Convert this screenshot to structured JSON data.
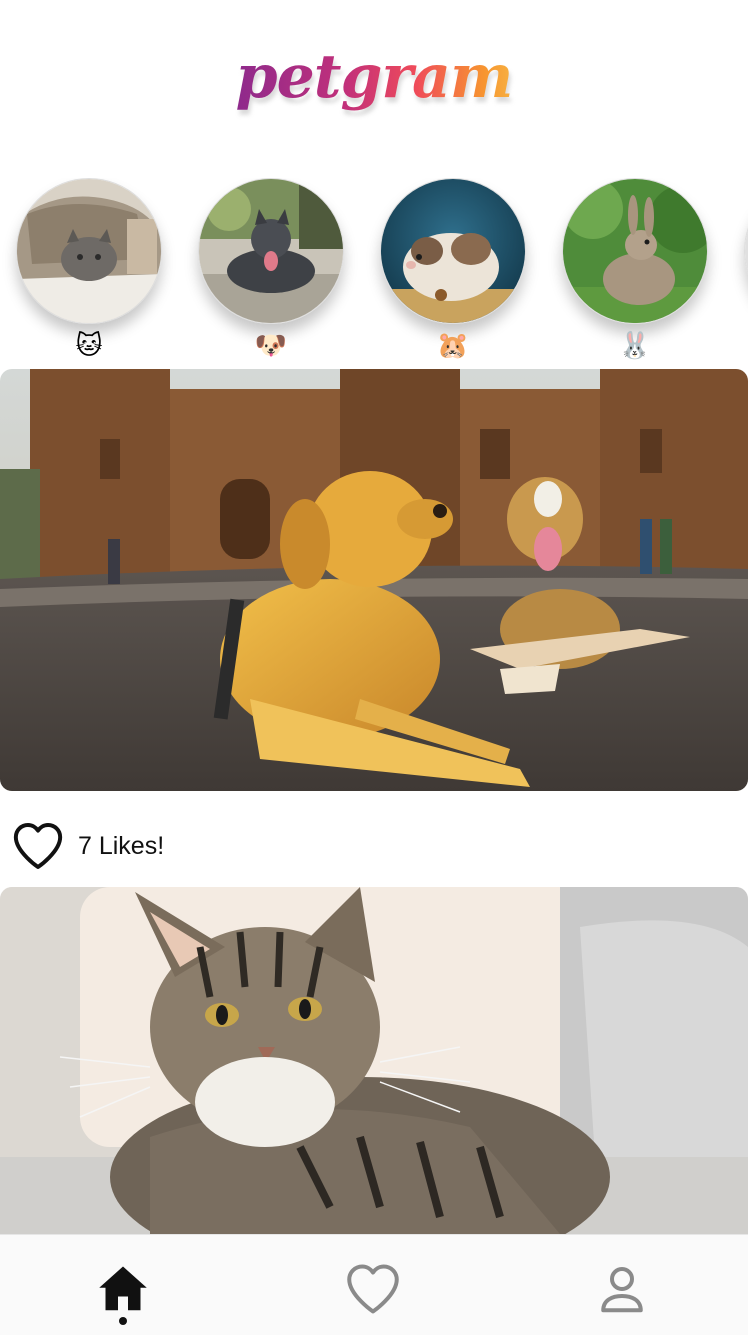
{
  "app": {
    "logo_text": "petgram"
  },
  "stories": [
    {
      "name": "cats",
      "emoji": "🐱",
      "photo": "cat-under-blanket"
    },
    {
      "name": "dogs",
      "emoji": "🐶",
      "photo": "pitbull-on-street"
    },
    {
      "name": "hamsters",
      "emoji": "🐹",
      "photo": "hamster"
    },
    {
      "name": "rabbits",
      "emoji": "🐰",
      "photo": "rabbit-on-grass"
    }
  ],
  "posts": [
    {
      "photo": "two-dogs-in-front-of-cathedral",
      "likes_text": "7 Likes!"
    },
    {
      "photo": "tabby-cat-on-sofa"
    }
  ],
  "bottom_nav": [
    {
      "name": "home",
      "icon": "home-icon",
      "active": true
    },
    {
      "name": "favorites",
      "icon": "heart-icon",
      "active": false
    },
    {
      "name": "user",
      "icon": "user-icon",
      "active": false
    }
  ],
  "colors": {
    "logo_gradient": [
      "#8e2a8c",
      "#c2307a",
      "#ef4b5a",
      "#f79530",
      "#f7b041"
    ],
    "active_nav": "#111111",
    "inactive_nav": "#888888"
  }
}
